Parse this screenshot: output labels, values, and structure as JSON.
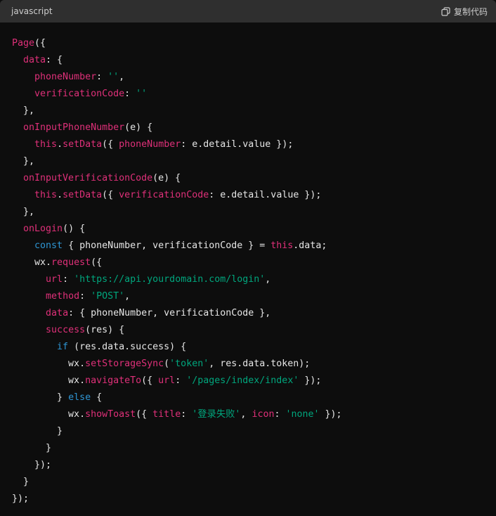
{
  "header": {
    "language": "javascript",
    "copy_label": "复制代码",
    "copy_icon": "copy-icon"
  },
  "colors": {
    "background": "#0d0d0d",
    "header": "#2f2f2f",
    "plain": "#e6e6e6",
    "property": "#df3079",
    "keyword": "#2e95d3",
    "string": "#00a67d"
  },
  "code_lines": [
    [
      [
        "p",
        "Page"
      ],
      [
        "t",
        "({"
      ]
    ],
    [
      [
        "t",
        "  "
      ],
      [
        "p",
        "data"
      ],
      [
        "t",
        ": {"
      ]
    ],
    [
      [
        "t",
        "    "
      ],
      [
        "p",
        "phoneNumber"
      ],
      [
        "t",
        ": "
      ],
      [
        "s",
        "''"
      ],
      [
        "t",
        ","
      ]
    ],
    [
      [
        "t",
        "    "
      ],
      [
        "p",
        "verificationCode"
      ],
      [
        "t",
        ": "
      ],
      [
        "s",
        "''"
      ]
    ],
    [
      [
        "t",
        "  },"
      ]
    ],
    [
      [
        "t",
        "  "
      ],
      [
        "p",
        "onInputPhoneNumber"
      ],
      [
        "t",
        "(e) {"
      ]
    ],
    [
      [
        "t",
        "    "
      ],
      [
        "p",
        "this"
      ],
      [
        "t",
        "."
      ],
      [
        "p",
        "setData"
      ],
      [
        "t",
        "({ "
      ],
      [
        "p",
        "phoneNumber"
      ],
      [
        "t",
        ": e.detail.value });"
      ]
    ],
    [
      [
        "t",
        "  },"
      ]
    ],
    [
      [
        "t",
        "  "
      ],
      [
        "p",
        "onInputVerificationCode"
      ],
      [
        "t",
        "(e) {"
      ]
    ],
    [
      [
        "t",
        "    "
      ],
      [
        "p",
        "this"
      ],
      [
        "t",
        "."
      ],
      [
        "p",
        "setData"
      ],
      [
        "t",
        "({ "
      ],
      [
        "p",
        "verificationCode"
      ],
      [
        "t",
        ": e.detail.value });"
      ]
    ],
    [
      [
        "t",
        "  },"
      ]
    ],
    [
      [
        "t",
        "  "
      ],
      [
        "p",
        "onLogin"
      ],
      [
        "t",
        "() {"
      ]
    ],
    [
      [
        "t",
        "    "
      ],
      [
        "k",
        "const"
      ],
      [
        "t",
        " { phoneNumber, verificationCode } = "
      ],
      [
        "p",
        "this"
      ],
      [
        "t",
        ".data;"
      ]
    ],
    [
      [
        "t",
        "    wx."
      ],
      [
        "p",
        "request"
      ],
      [
        "t",
        "({"
      ]
    ],
    [
      [
        "t",
        "      "
      ],
      [
        "p",
        "url"
      ],
      [
        "t",
        ": "
      ],
      [
        "s",
        "'https://api.yourdomain.com/login'"
      ],
      [
        "t",
        ","
      ]
    ],
    [
      [
        "t",
        "      "
      ],
      [
        "p",
        "method"
      ],
      [
        "t",
        ": "
      ],
      [
        "s",
        "'POST'"
      ],
      [
        "t",
        ","
      ]
    ],
    [
      [
        "t",
        "      "
      ],
      [
        "p",
        "data"
      ],
      [
        "t",
        ": { phoneNumber, verificationCode },"
      ]
    ],
    [
      [
        "t",
        "      "
      ],
      [
        "p",
        "success"
      ],
      [
        "t",
        "(res) {"
      ]
    ],
    [
      [
        "t",
        "        "
      ],
      [
        "k",
        "if"
      ],
      [
        "t",
        " (res.data.success) {"
      ]
    ],
    [
      [
        "t",
        "          wx."
      ],
      [
        "p",
        "setStorageSync"
      ],
      [
        "t",
        "("
      ],
      [
        "s",
        "'token'"
      ],
      [
        "t",
        ", res.data.token);"
      ]
    ],
    [
      [
        "t",
        "          wx."
      ],
      [
        "p",
        "navigateTo"
      ],
      [
        "t",
        "({ "
      ],
      [
        "p",
        "url"
      ],
      [
        "t",
        ": "
      ],
      [
        "s",
        "'/pages/index/index'"
      ],
      [
        "t",
        " });"
      ]
    ],
    [
      [
        "t",
        "        } "
      ],
      [
        "k",
        "else"
      ],
      [
        "t",
        " {"
      ]
    ],
    [
      [
        "t",
        "          wx."
      ],
      [
        "p",
        "showToast"
      ],
      [
        "t",
        "({ "
      ],
      [
        "p",
        "title"
      ],
      [
        "t",
        ": "
      ],
      [
        "s",
        "'登录失败'"
      ],
      [
        "t",
        ", "
      ],
      [
        "p",
        "icon"
      ],
      [
        "t",
        ": "
      ],
      [
        "s",
        "'none'"
      ],
      [
        "t",
        " });"
      ]
    ],
    [
      [
        "t",
        "        }"
      ]
    ],
    [
      [
        "t",
        "      }"
      ]
    ],
    [
      [
        "t",
        "    });"
      ]
    ],
    [
      [
        "t",
        "  }"
      ]
    ],
    [
      [
        "t",
        "});"
      ]
    ]
  ]
}
